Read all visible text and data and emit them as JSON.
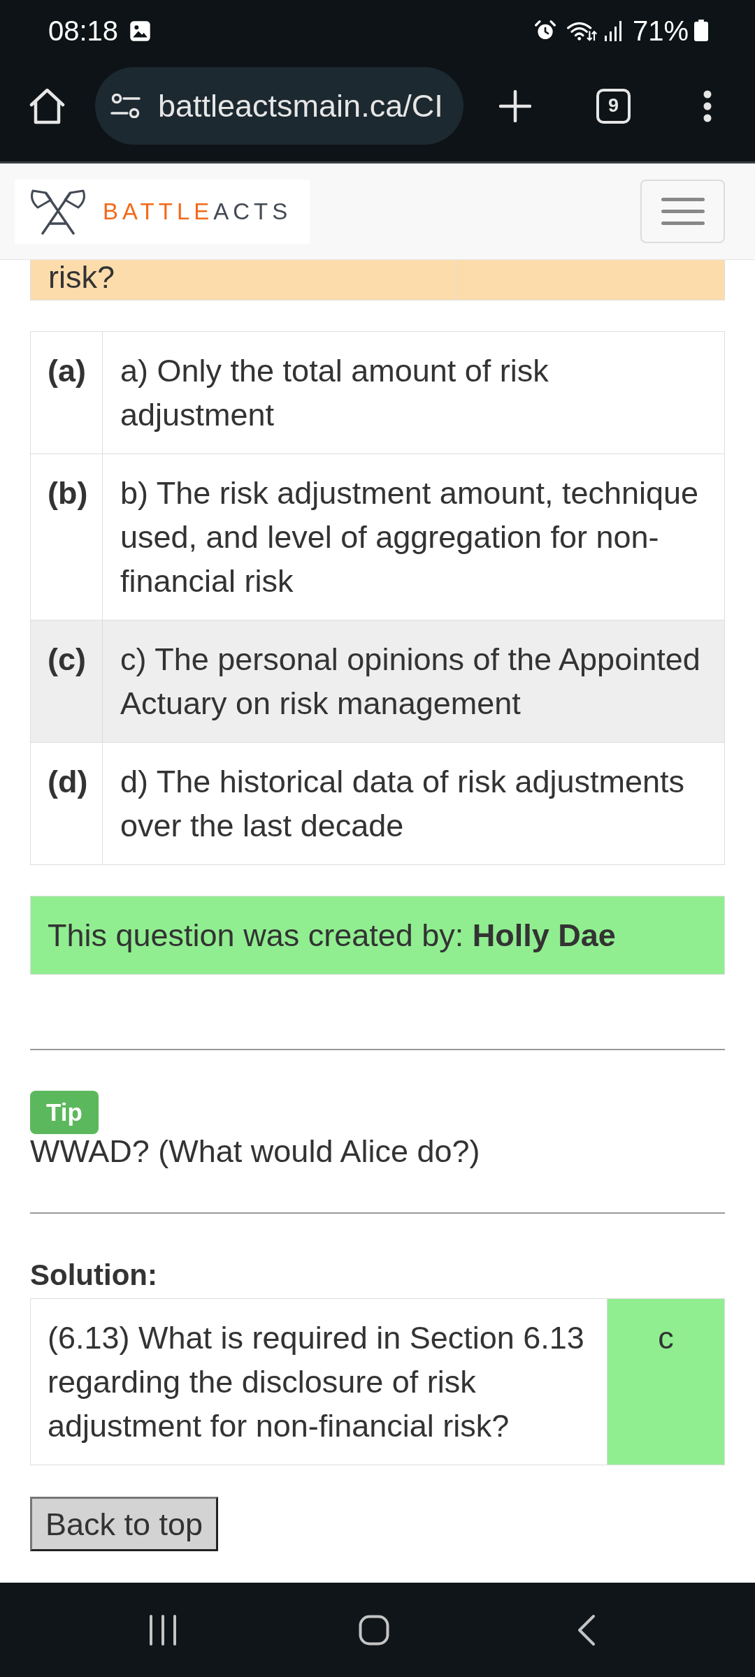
{
  "status_bar": {
    "time": "08:18",
    "battery": "71%"
  },
  "browser": {
    "url": "battleactsmain.ca/CI",
    "tab_count": "9"
  },
  "site_header": {
    "logo": {
      "accent": "BATTLE",
      "rest": "ACTS"
    }
  },
  "question_row": {
    "text": "risk?"
  },
  "options": [
    {
      "letter": "(a)",
      "text": "a) Only the total amount of risk adjustment",
      "highlighted": false
    },
    {
      "letter": "(b)",
      "text": "b) The risk adjustment amount, technique used, and level of aggregation for non-financial risk",
      "highlighted": false
    },
    {
      "letter": "(c)",
      "text": "c) The personal opinions of the Appointed Actuary on risk management",
      "highlighted": true
    },
    {
      "letter": "(d)",
      "text": "d) The historical data of risk adjustments over the last decade",
      "highlighted": false
    }
  ],
  "credit": "This question was created by: **Holly Dae**",
  "tip": {
    "badge": "Tip",
    "text": "WWAD? (What would Alice do?)"
  },
  "solution": {
    "heading": "Solution:",
    "question": "(6.13) What is required in Section 6.13 regarding the disclosure of risk adjustment for non-financial risk?",
    "answer": "c"
  },
  "back_to_top": "Back to top"
}
